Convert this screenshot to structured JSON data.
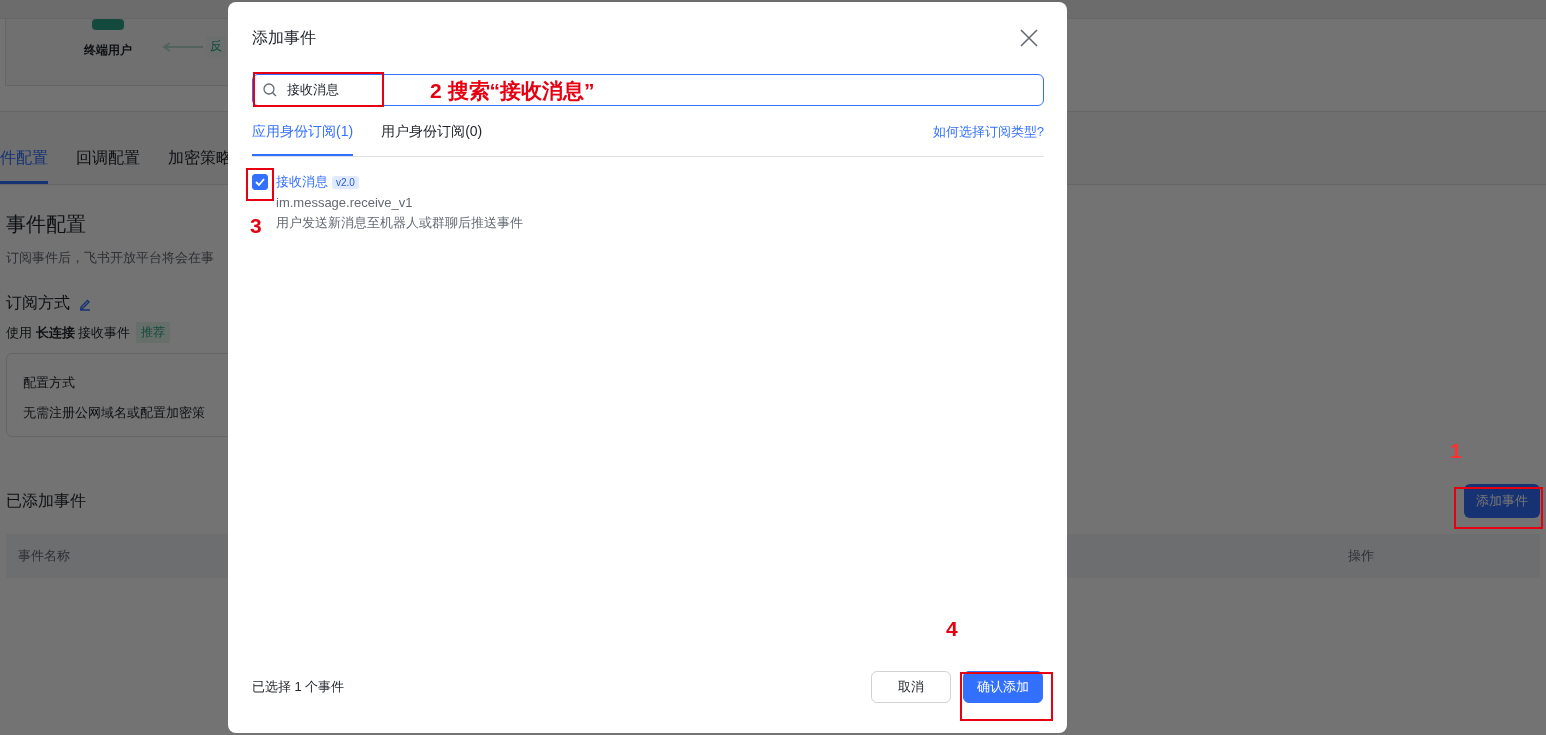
{
  "page": {
    "diagram": {
      "node_label": "终端用户",
      "edge_label": "反"
    },
    "tabs": [
      {
        "label": "件配置",
        "selected": true
      },
      {
        "label": "回调配置",
        "selected": false
      },
      {
        "label": "加密策略",
        "selected": false
      }
    ],
    "section_title": "事件配置",
    "description": "订阅事件后，飞书开放平台将会在事",
    "subscription": {
      "title": "订阅方式",
      "text": "使用 **长连接** 接收事件",
      "tag": "推荐"
    },
    "config_card": {
      "title": "配置方式",
      "text": "无需注册公网域名或配置加密策"
    },
    "added_events": {
      "title": "已添加事件",
      "add_button": "添加事件",
      "columns": [
        "事件名称",
        "操作"
      ]
    }
  },
  "dialog": {
    "title": "添加事件",
    "search": {
      "value": "接收消息"
    },
    "tabs": [
      {
        "label": "应用身份订阅(1)",
        "selected": true
      },
      {
        "label": "用户身份订阅(0)",
        "selected": false
      }
    ],
    "help_link": "如何选择订阅类型?",
    "events": [
      {
        "name": "接收消息",
        "version": "v2.0",
        "key": "im.message.receive_v1",
        "description": "用户发送新消息至机器人或群聊后推送事件",
        "checked": true
      }
    ],
    "footer_text": "已选择 1 个事件",
    "buttons": [
      {
        "label": "取消",
        "kind": "secondary"
      },
      {
        "label": "确认添加",
        "kind": "primary"
      }
    ]
  },
  "annotations": [
    {
      "label": "1"
    },
    {
      "label": "2 搜索“接收消息”"
    },
    {
      "label": "3"
    },
    {
      "label": "4"
    }
  ]
}
